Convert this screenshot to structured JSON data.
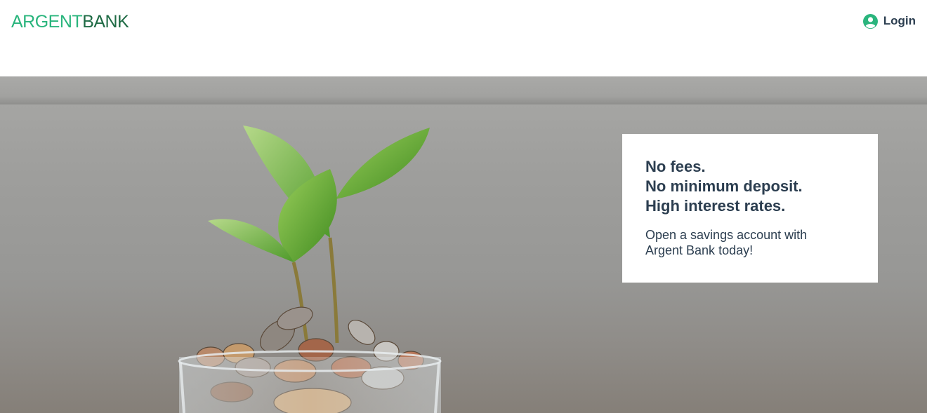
{
  "header": {
    "logo_part1": "ARGENT",
    "logo_part2": "BANK",
    "login_label": "Login",
    "login_icon": "user-circle-icon",
    "colors": {
      "brand_green": "#2ab57d",
      "brand_dark_green": "#1f6b45",
      "text": "#2c3e50"
    }
  },
  "hero": {
    "image": "plant-sprouting-from-jar-of-coins",
    "subtitles": [
      "No fees.",
      "No minimum deposit.",
      "High interest rates."
    ],
    "text": "Open a savings account with Argent Bank today!"
  }
}
